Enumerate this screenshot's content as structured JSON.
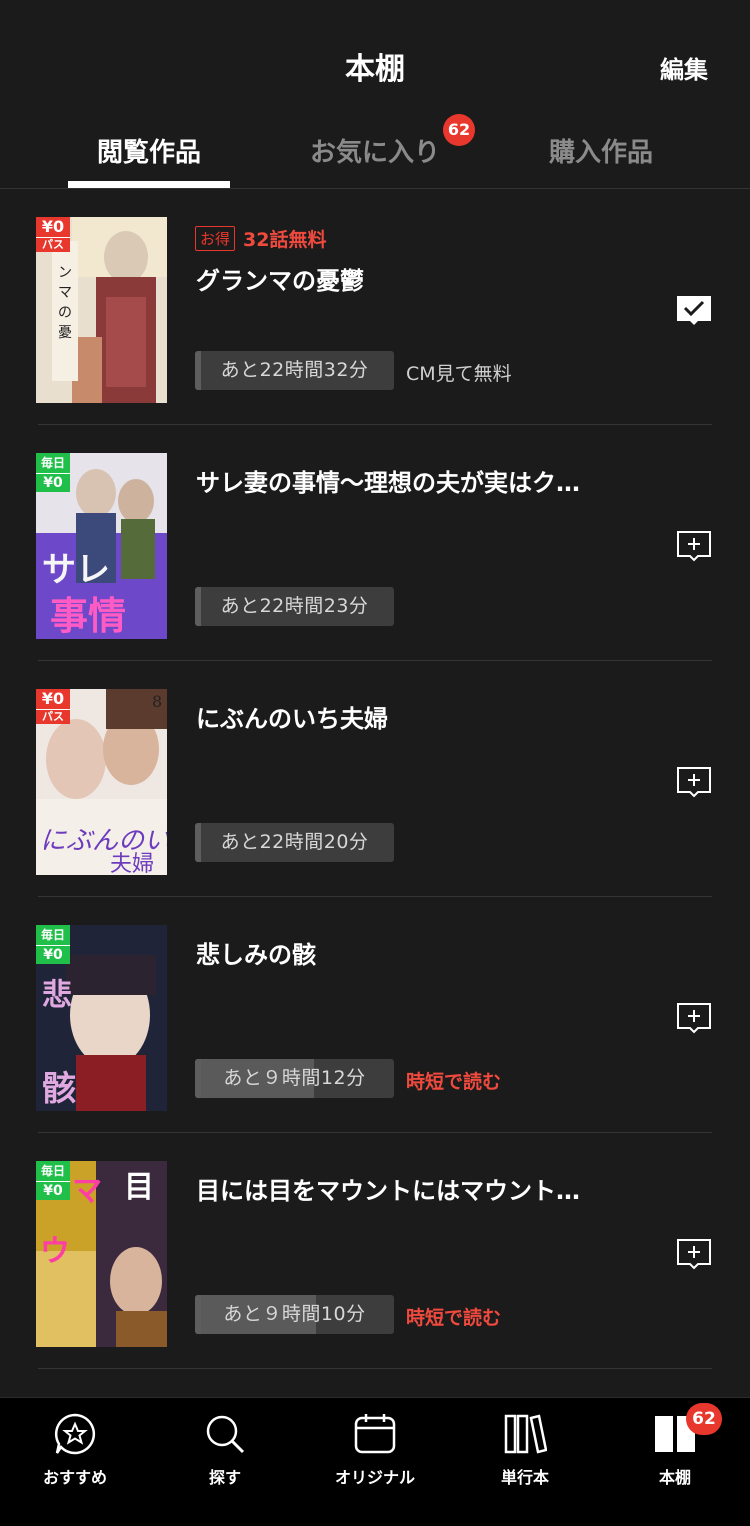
{
  "header": {
    "title": "本棚",
    "edit_label": "編集"
  },
  "tabs": [
    {
      "label": "閲覧作品",
      "active": true
    },
    {
      "label": "お気に入り",
      "badge": "62"
    },
    {
      "label": "購入作品"
    }
  ],
  "books": [
    {
      "title": "グランマの憂鬱",
      "cover_badge": [
        "¥0",
        "パス"
      ],
      "cover_badge_color": "red",
      "deal_tag": "お得",
      "deal_text": "32話無料",
      "timer": "あと22時間32分",
      "timer_progress": 0.0,
      "after_text": "CM見て無料",
      "after_style": "cm",
      "in_shelf": true,
      "shelf_icon": "check-icon"
    },
    {
      "title": "サレ妻の事情〜理想の夫が実はク…",
      "cover_badge": [
        "毎日",
        "¥0"
      ],
      "cover_badge_color": "green",
      "timer": "あと22時間23分",
      "timer_progress": 0.0,
      "in_shelf": false,
      "shelf_icon": "add-to-shelf-icon"
    },
    {
      "title": "にぶんのいち夫婦",
      "cover_badge": [
        "¥0",
        "パス"
      ],
      "cover_badge_color": "red",
      "timer": "あと22時間20分",
      "timer_progress": 0.0,
      "in_shelf": false,
      "shelf_icon": "add-to-shelf-icon"
    },
    {
      "title": "悲しみの骸",
      "cover_badge": [
        "毎日",
        "¥0"
      ],
      "cover_badge_color": "green",
      "timer": "あと９時間12分",
      "timer_progress": 0.6,
      "after_text": "時短で読む",
      "after_style": "red",
      "in_shelf": false,
      "shelf_icon": "add-to-shelf-icon"
    },
    {
      "title": "目には目をマウントにはマウント…",
      "cover_badge": [
        "毎日",
        "¥0"
      ],
      "cover_badge_color": "green",
      "timer": "あと９時間10分",
      "timer_progress": 0.61,
      "after_text": "時短で読む",
      "after_style": "red",
      "in_shelf": false,
      "shelf_icon": "add-to-shelf-icon"
    }
  ],
  "nav": {
    "items": [
      {
        "label": "おすすめ",
        "icon": "recommend-icon"
      },
      {
        "label": "探す",
        "icon": "search-icon"
      },
      {
        "label": "オリジナル",
        "icon": "calendar-icon"
      },
      {
        "label": "単行本",
        "icon": "books-icon"
      },
      {
        "label": "本棚",
        "icon": "bookshelf-icon",
        "active": true,
        "badge": "62"
      }
    ]
  },
  "colors": {
    "background": "#1b1b1b",
    "accent_red": "#e8372c",
    "badge_green": "#1fbf4a",
    "nav_background": "#000000"
  }
}
